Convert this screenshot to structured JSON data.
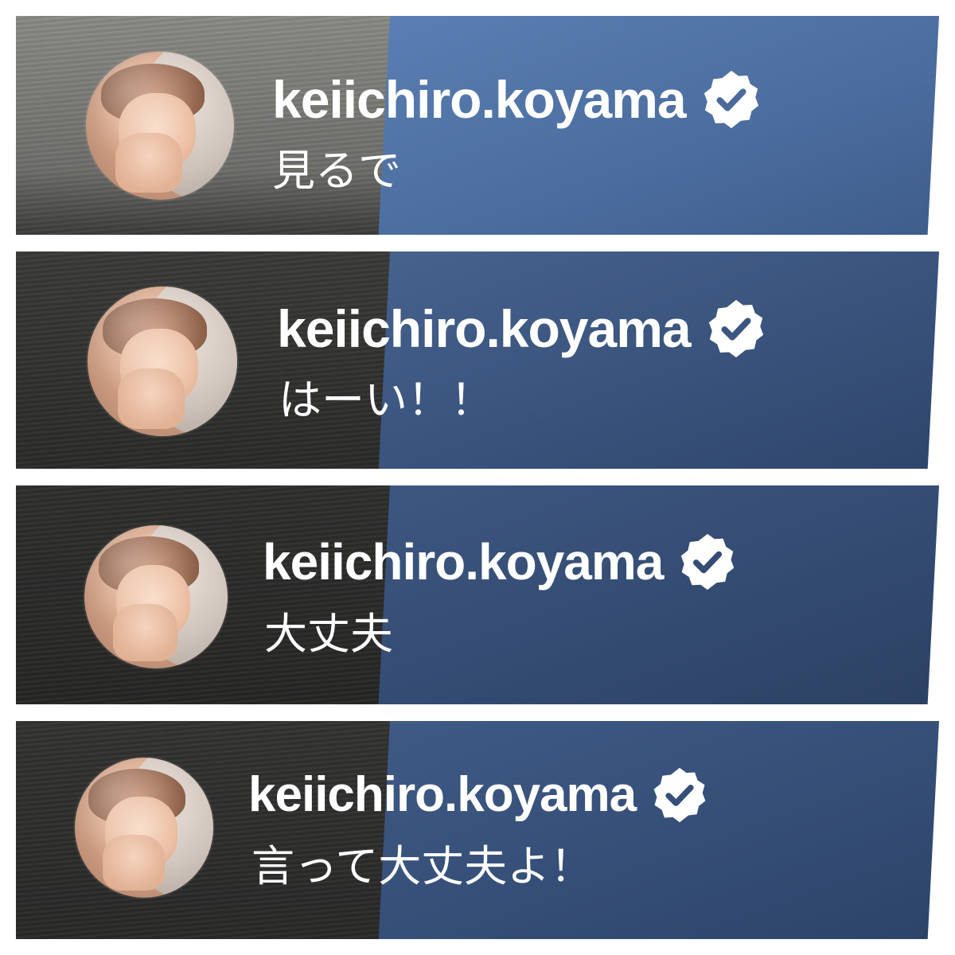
{
  "panels": [
    {
      "username": "keiichiro.koyama",
      "comment": "見るで",
      "verified": true,
      "avatar_icon": "profile-avatar"
    },
    {
      "username": "keiichiro.koyama",
      "comment": "はーい！！",
      "verified": true,
      "avatar_icon": "profile-avatar"
    },
    {
      "username": "keiichiro.koyama",
      "comment": "大丈夫",
      "verified": true,
      "avatar_icon": "profile-avatar"
    },
    {
      "username": "keiichiro.koyama",
      "comment": "言って大丈夫よ！",
      "verified": true,
      "avatar_icon": "profile-avatar"
    }
  ],
  "colors": {
    "text": "#ffffff",
    "verified_badge": "#ffffff",
    "background_blue": "#3f5d8c",
    "background_dark": "#2b2b2a",
    "separator": "#ffffff"
  }
}
